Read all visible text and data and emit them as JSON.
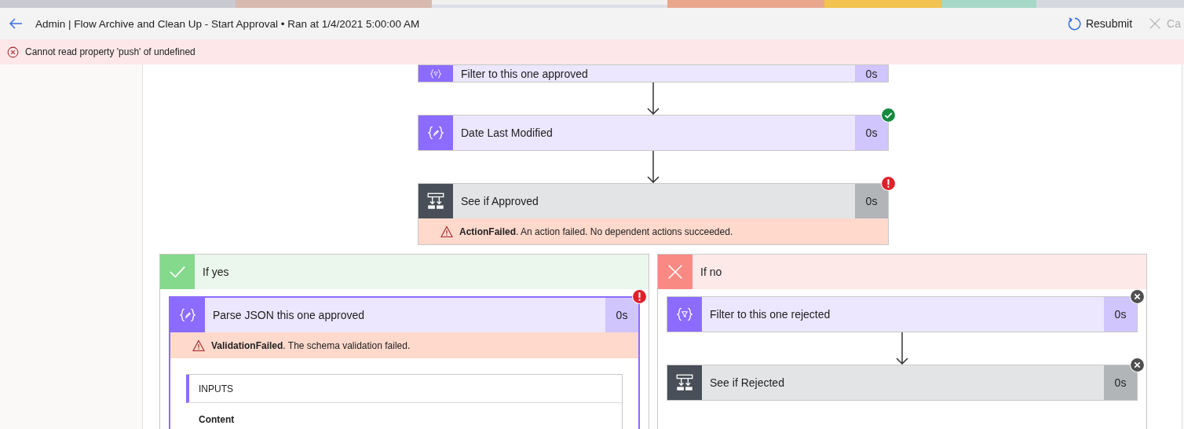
{
  "header": {
    "title": "Admin | Flow Archive and Clean Up - Start Approval • Ran at 1/4/2021 5:00:00 AM",
    "buttons": [
      {
        "label": "Resubmit",
        "kind": "resubmit",
        "disabled": false
      },
      {
        "label": "Ca",
        "kind": "cancel",
        "disabled": true
      }
    ]
  },
  "error_banner": {
    "message": "Cannot read property 'push' of undefined"
  },
  "steps": [
    {
      "title": "Filter to this one approved",
      "duration": "0s",
      "kind": "filter",
      "succeeded": false,
      "failed": false,
      "skipped": false,
      "cut_off": true
    },
    {
      "title": "Date Last Modified",
      "duration": "0s",
      "kind": "compose",
      "succeeded": true,
      "failed": false,
      "skipped": false,
      "cut_off": false
    },
    {
      "title": "See if Approved",
      "duration": "0s",
      "kind": "condition",
      "succeeded": false,
      "failed": true,
      "skipped": false,
      "cut_off": false,
      "error": "**ActionFailed**. An action failed. No dependent actions succeeded."
    }
  ],
  "branches": [
    {
      "label": "If yes",
      "kind": "yes",
      "steps": [
        {
          "title": "Parse JSON this one approved",
          "duration": "0s",
          "kind": "compose",
          "succeeded": false,
          "failed": true,
          "skipped": false,
          "selected": true,
          "error": "**ValidationFailed**. The schema validation failed.",
          "inputs": {
            "heading": "INPUTS",
            "fields": [
              "Content"
            ]
          }
        }
      ]
    },
    {
      "label": "If no",
      "kind": "no",
      "steps": [
        {
          "title": "Filter to this one rejected",
          "duration": "0s",
          "kind": "filter",
          "succeeded": false,
          "failed": false,
          "skipped": true,
          "selected": false
        },
        {
          "title": "See if Rejected",
          "duration": "0s",
          "kind": "condition",
          "succeeded": false,
          "failed": false,
          "skipped": true,
          "selected": false
        }
      ]
    }
  ]
}
